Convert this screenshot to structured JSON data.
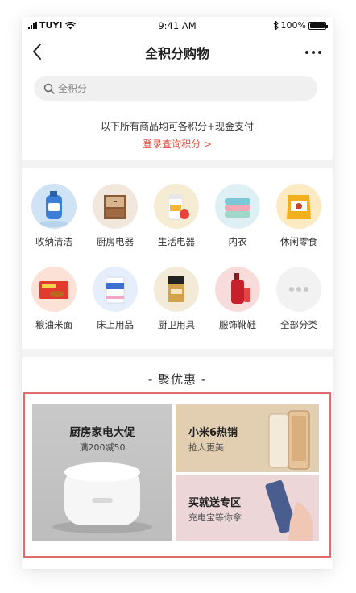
{
  "status_bar": {
    "carrier": "TUYI",
    "time": "9:41 AM",
    "battery": "100%"
  },
  "nav": {
    "title": "全积分购物"
  },
  "search": {
    "placeholder": "全积分"
  },
  "notice": {
    "text": "以下所有商品均可各积分+现金支付",
    "login_link": "登录查询积分 >"
  },
  "categories": [
    {
      "label": "收纳清洁",
      "icon": "detergent-icon"
    },
    {
      "label": "厨房电器",
      "icon": "cabinet-icon"
    },
    {
      "label": "生活电器",
      "icon": "vitamin-bottle-icon"
    },
    {
      "label": "内衣",
      "icon": "towels-icon"
    },
    {
      "label": "休闲零食",
      "icon": "snack-bag-icon"
    },
    {
      "label": "粮油米面",
      "icon": "noodle-pack-icon"
    },
    {
      "label": "床上用品",
      "icon": "box-icon"
    },
    {
      "label": "厨卫用具",
      "icon": "cosmetic-jar-icon"
    },
    {
      "label": "服饰靴鞋",
      "icon": "lotion-bottle-icon"
    },
    {
      "label": "全部分类",
      "icon": "more-dots-icon"
    }
  ],
  "section": {
    "title": "- 聚优惠 -"
  },
  "promos": {
    "big": {
      "title": "厨房家电大促",
      "subtitle": "满200减50"
    },
    "top": {
      "title": "小米6热销",
      "subtitle": "抢人更美"
    },
    "bottom": {
      "title": "买就送专区",
      "subtitle": "充电宝等你拿"
    }
  },
  "colors": {
    "accent": "#e24a3b",
    "frame": "#e06b6b"
  }
}
